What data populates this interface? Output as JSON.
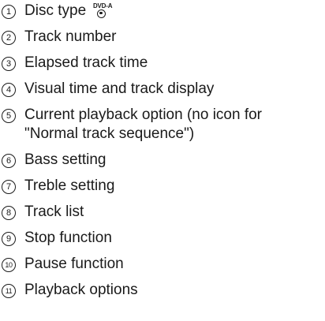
{
  "items": [
    {
      "number": "1",
      "label": "Disc type",
      "icon_label": "DVD-A",
      "icon": "dvd-audio-disc-icon"
    },
    {
      "number": "2",
      "label": "Track number"
    },
    {
      "number": "3",
      "label": "Elapsed track time"
    },
    {
      "number": "4",
      "label": "Visual time and track display"
    },
    {
      "number": "5",
      "label": "Current playback option (no icon for",
      "label_cont": "\"Normal track sequence\")"
    },
    {
      "number": "6",
      "label": "Bass setting"
    },
    {
      "number": "7",
      "label": "Treble setting"
    },
    {
      "number": "8",
      "label": "Track list"
    },
    {
      "number": "9",
      "label": "Stop function"
    },
    {
      "number": "10",
      "label": "Pause function"
    },
    {
      "number": "11",
      "label": "Playback options"
    }
  ]
}
